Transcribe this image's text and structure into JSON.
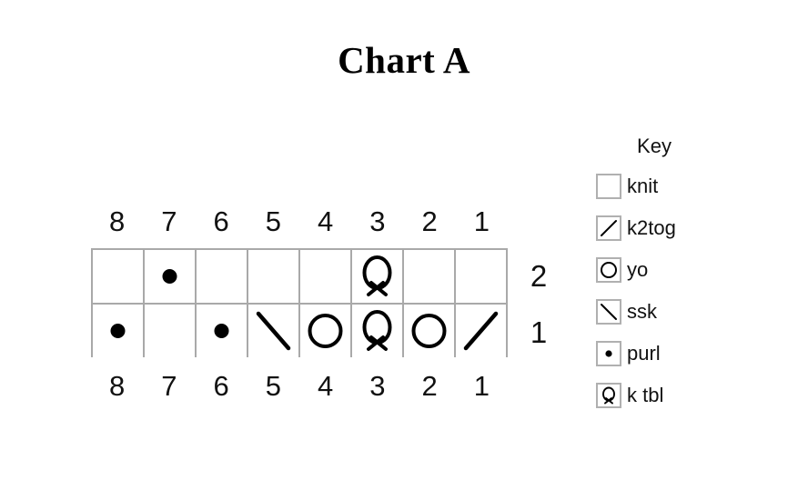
{
  "title": "Chart A",
  "chart_data": {
    "type": "table",
    "title": "Chart A",
    "subtitle": "",
    "xlabel": "",
    "ylabel": "",
    "description": "Knitting stitch chart grid, 8 stitches wide by 2 rows tall, read right-to-left with stitch numbers 8 to 1 shown above and below the grid and row numbers 2 and 1 at the right.",
    "columns": 8,
    "rows": 2,
    "column_numbers": [
      "8",
      "7",
      "6",
      "5",
      "4",
      "3",
      "2",
      "1"
    ],
    "row_numbers": [
      "2",
      "1"
    ],
    "symbol_legend": {
      "knit": "blank square",
      "k2tog": "forward slash",
      "yo": "open circle",
      "ssk": "back slash",
      "purl": "filled dot",
      "k tbl": "Q / omega loop"
    },
    "cells": [
      {
        "row": "2",
        "stitches": [
          {
            "col": "8",
            "symbol": "knit"
          },
          {
            "col": "7",
            "symbol": "purl"
          },
          {
            "col": "6",
            "symbol": "knit"
          },
          {
            "col": "5",
            "symbol": "knit"
          },
          {
            "col": "4",
            "symbol": "knit"
          },
          {
            "col": "3",
            "symbol": "k tbl"
          },
          {
            "col": "2",
            "symbol": "knit"
          },
          {
            "col": "1",
            "symbol": "knit"
          }
        ]
      },
      {
        "row": "1",
        "stitches": [
          {
            "col": "8",
            "symbol": "purl"
          },
          {
            "col": "7",
            "symbol": "knit"
          },
          {
            "col": "6",
            "symbol": "purl"
          },
          {
            "col": "5",
            "symbol": "ssk"
          },
          {
            "col": "4",
            "symbol": "yo"
          },
          {
            "col": "3",
            "symbol": "k tbl"
          },
          {
            "col": "2",
            "symbol": "yo"
          },
          {
            "col": "1",
            "symbol": "k2tog"
          }
        ]
      }
    ],
    "grid": true,
    "legend_position": "right",
    "colors": {
      "grid_line": "#a9a9a9",
      "symbol": "#000000",
      "text": "#111111",
      "background": "#ffffff",
      "key_box_border": "#b0b0b0"
    }
  },
  "column_numbers_top": [
    "8",
    "7",
    "6",
    "5",
    "4",
    "3",
    "2",
    "1"
  ],
  "column_numbers_bottom": [
    "8",
    "7",
    "6",
    "5",
    "4",
    "3",
    "2",
    "1"
  ],
  "row_labels": {
    "top": "2",
    "bottom": "1"
  },
  "key": {
    "heading": "Key",
    "items": [
      {
        "symbol": "knit",
        "label": "knit"
      },
      {
        "symbol": "k2tog",
        "label": "k2tog"
      },
      {
        "symbol": "yo",
        "label": "yo"
      },
      {
        "symbol": "ssk",
        "label": "ssk"
      },
      {
        "symbol": "purl",
        "label": "purl"
      },
      {
        "symbol": "ktbl",
        "label": "k tbl"
      }
    ]
  }
}
